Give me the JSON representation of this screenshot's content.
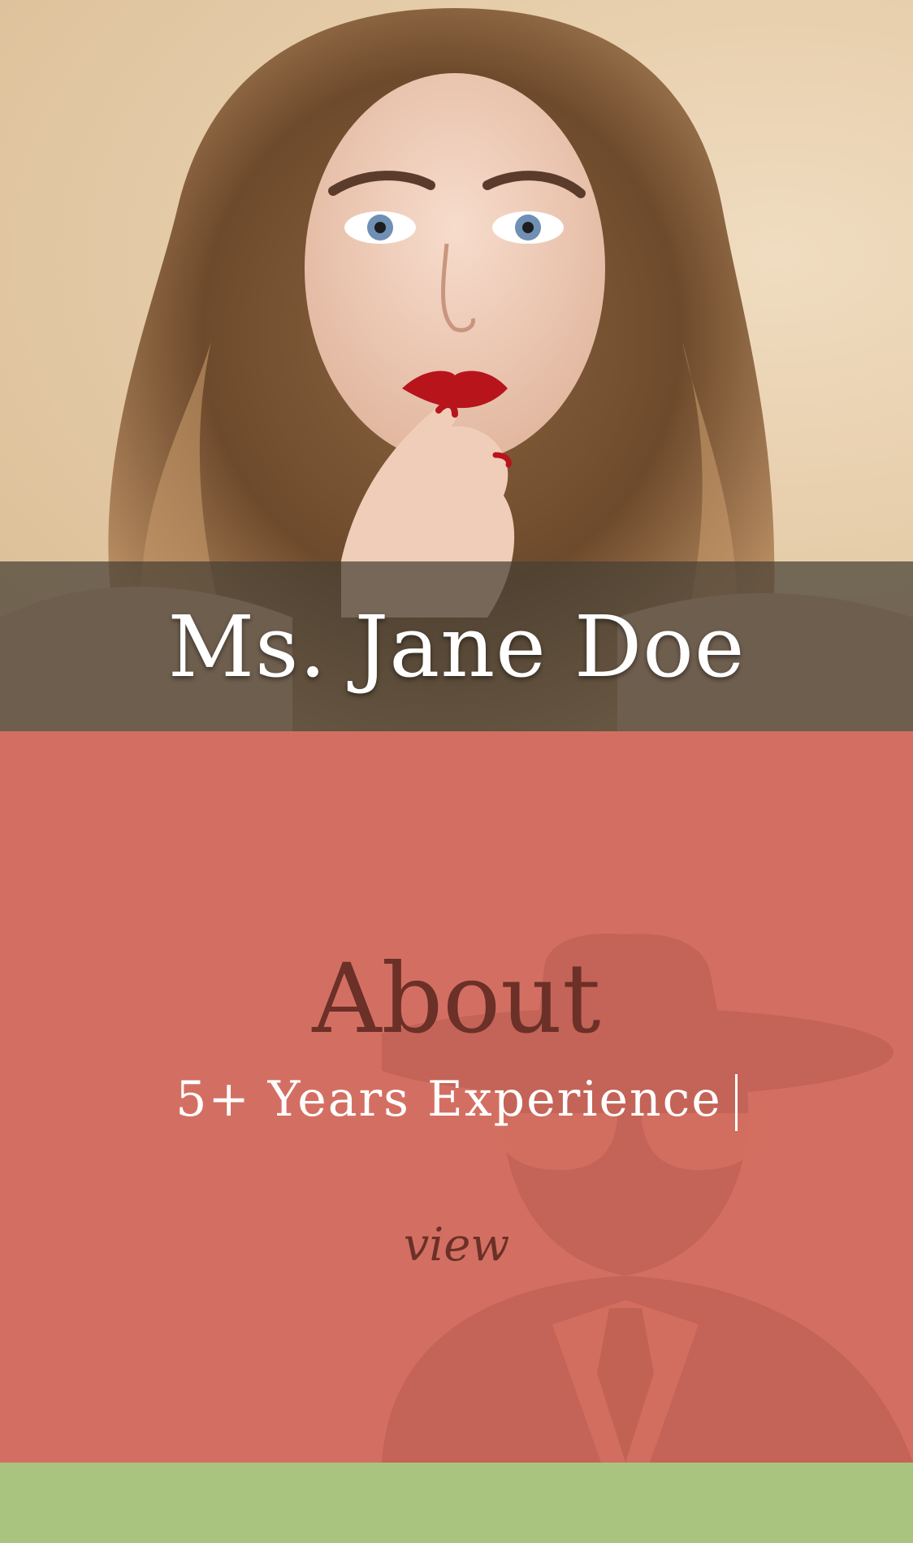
{
  "profile": {
    "name": "Ms. Jane Doe"
  },
  "about": {
    "heading": "About",
    "tagline": "5+ Years Experience",
    "view_label": "view"
  },
  "colors": {
    "about_background": "#d36f62",
    "heading_color": "#6b3027",
    "footer_strip": "#a9c47e",
    "name_band": "rgba(70,64,52,0.72)"
  },
  "icons": {
    "about_background": "spy-silhouette-icon"
  }
}
